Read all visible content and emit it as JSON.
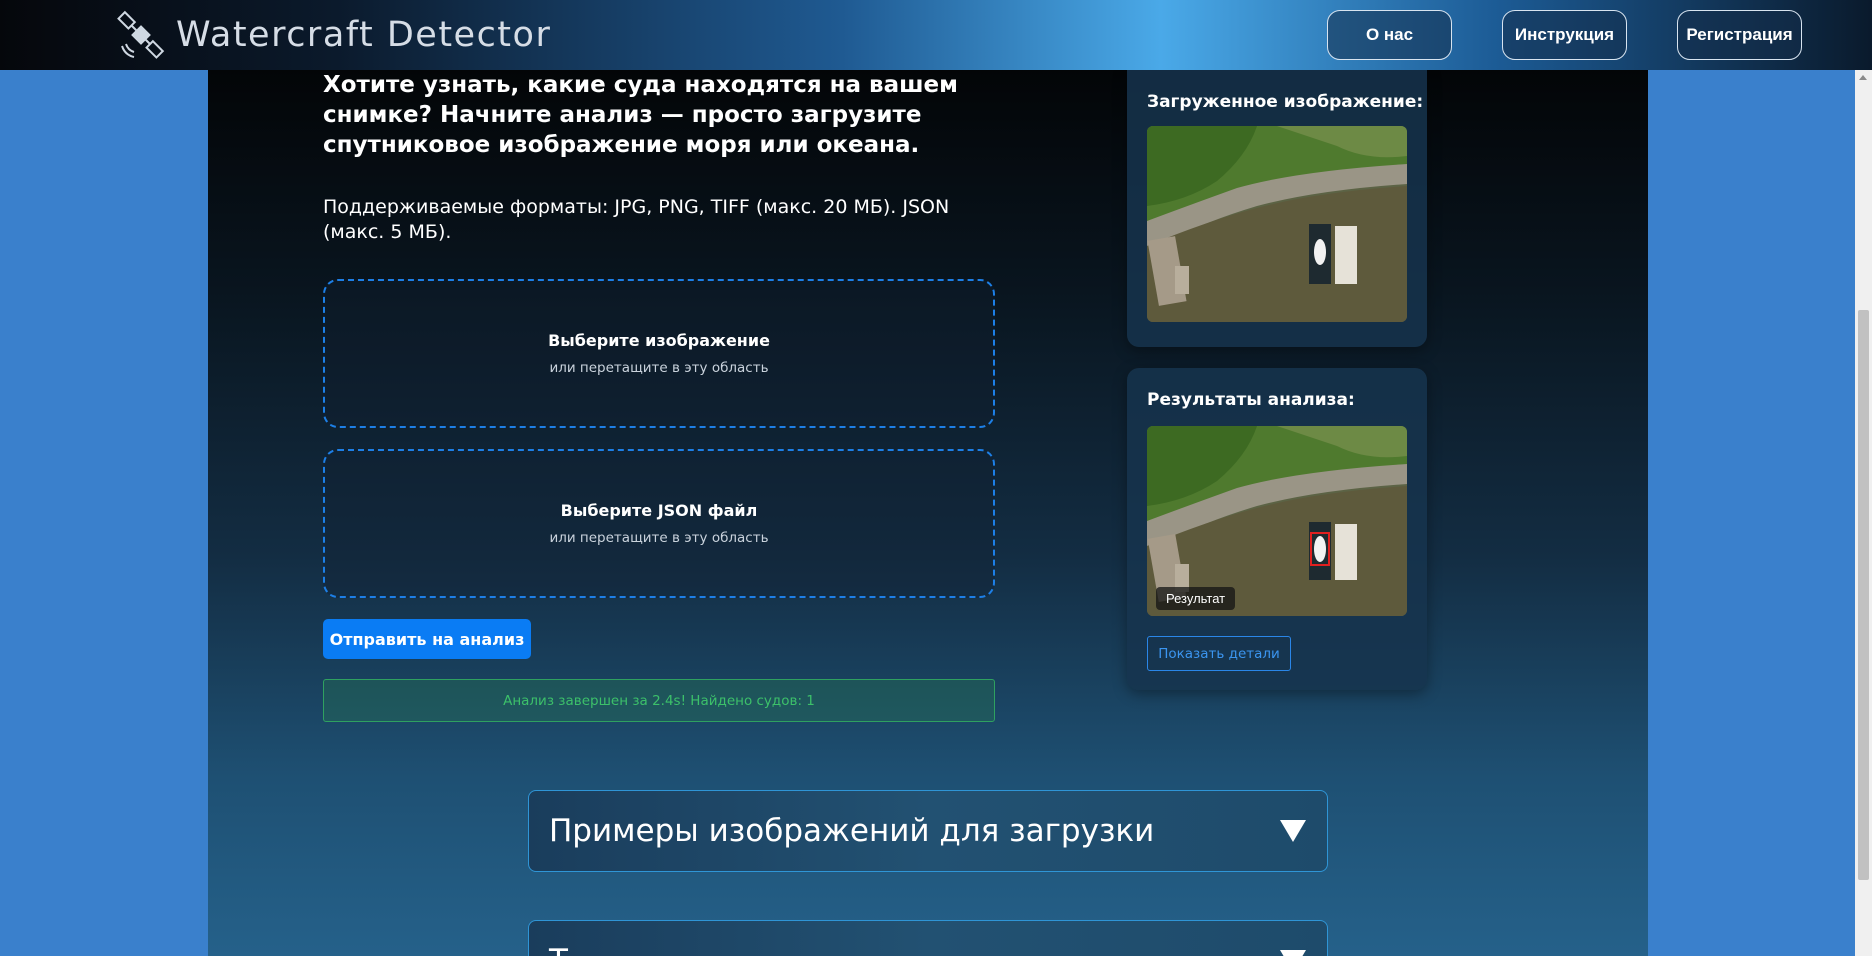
{
  "header": {
    "app_title": "Watercraft Detector",
    "logo_icon": "satellite-icon",
    "nav": {
      "about": "О нас",
      "guide": "Инструкция",
      "register": "Регистрация"
    }
  },
  "intro": {
    "headline": "Хотите узнать, какие суда находятся на вашем снимке? Начните анализ — просто загрузите спутниковое изображение моря или океана.",
    "formats": "Поддерживаемые форматы: JPG, PNG, TIFF (макс. 20 МБ). JSON (макс. 5 МБ)."
  },
  "upload": {
    "image_title": "Выберите изображение",
    "image_sub": "или перетащите в эту область",
    "json_title": "Выберите JSON файл",
    "json_sub": "или перетащите в эту область",
    "submit_label": "Отправить на анализ",
    "status": "Анализ завершен за 2.4s! Найдено судов: 1"
  },
  "uploaded_card": {
    "title": "Загруженное изображение:"
  },
  "results_card": {
    "title": "Результаты анализа:",
    "badge": "Результат",
    "details_label": "Показать детали"
  },
  "accordions": [
    {
      "title": "Примеры изображений для загрузки"
    },
    {
      "title": "Т"
    }
  ],
  "colors": {
    "accent": "#0a7cf4",
    "success": "#3cc06a",
    "page_bg": "#3a80cc"
  }
}
